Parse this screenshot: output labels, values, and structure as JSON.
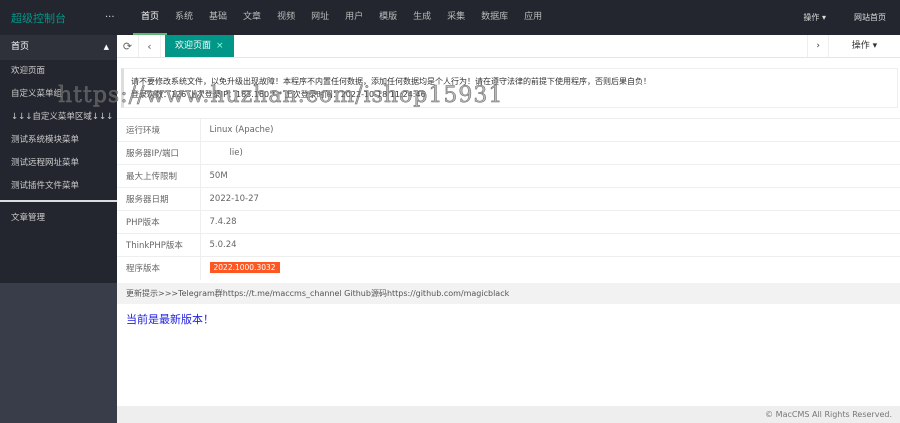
{
  "header": {
    "logo": "超级控制台",
    "more": "···",
    "nav": [
      "首页",
      "系统",
      "基础",
      "文章",
      "视频",
      "网址",
      "用户",
      "模版",
      "生成",
      "采集",
      "数据库",
      "应用"
    ],
    "ops": "操作 ▾",
    "home": "网站首页"
  },
  "sidebar": {
    "section": "首页",
    "items": [
      "欢迎页面",
      "自定义菜单组",
      "↓↓↓自定义菜单区域↓↓↓",
      "测试系统模块菜单",
      "测试远程网址菜单",
      "测试插件文件菜单"
    ],
    "section2": "文章管理"
  },
  "tabs": {
    "refresh": "⟳",
    "prev": "‹",
    "active": "欢迎页面",
    "close": "×",
    "next": "›",
    "ops": "操作 ▾"
  },
  "notice": {
    "line1": "请不要修改系统文件，以免升级出现故障！本程序不内置任何数据，添加任何数据均是个人行为！请在遵守法律的前提下使用程序，否则后果自负！",
    "line2": "登录次数：126 上次登录IP：183.160.*.* 上次登录时间：2022-10-18 11:24:46"
  },
  "info": [
    {
      "label": "运行环境",
      "value": "Linux (Apache)"
    },
    {
      "label": "服务器IP/端口",
      "value": "lie)"
    },
    {
      "label": "最大上传限制",
      "value": "50M"
    },
    {
      "label": "服务器日期",
      "value": "2022-10-27"
    },
    {
      "label": "PHP版本",
      "value": "7.4.28"
    },
    {
      "label": "ThinkPHP版本",
      "value": "5.0.24"
    },
    {
      "label": "程序版本",
      "value": "2022.1000.3032"
    }
  ],
  "update": "更新提示>>>Telegram群https://t.me/maccms_channel   Github源码https://github.com/magicblack",
  "latest": "当前是最新版本！",
  "footer": "© MacCMS All Rights Reserved.",
  "watermark": "https://www.huzhan.com/ishop15931",
  "colors": {
    "accent": "#009688",
    "badge": "#ff5722",
    "topbar": "#23262e"
  }
}
